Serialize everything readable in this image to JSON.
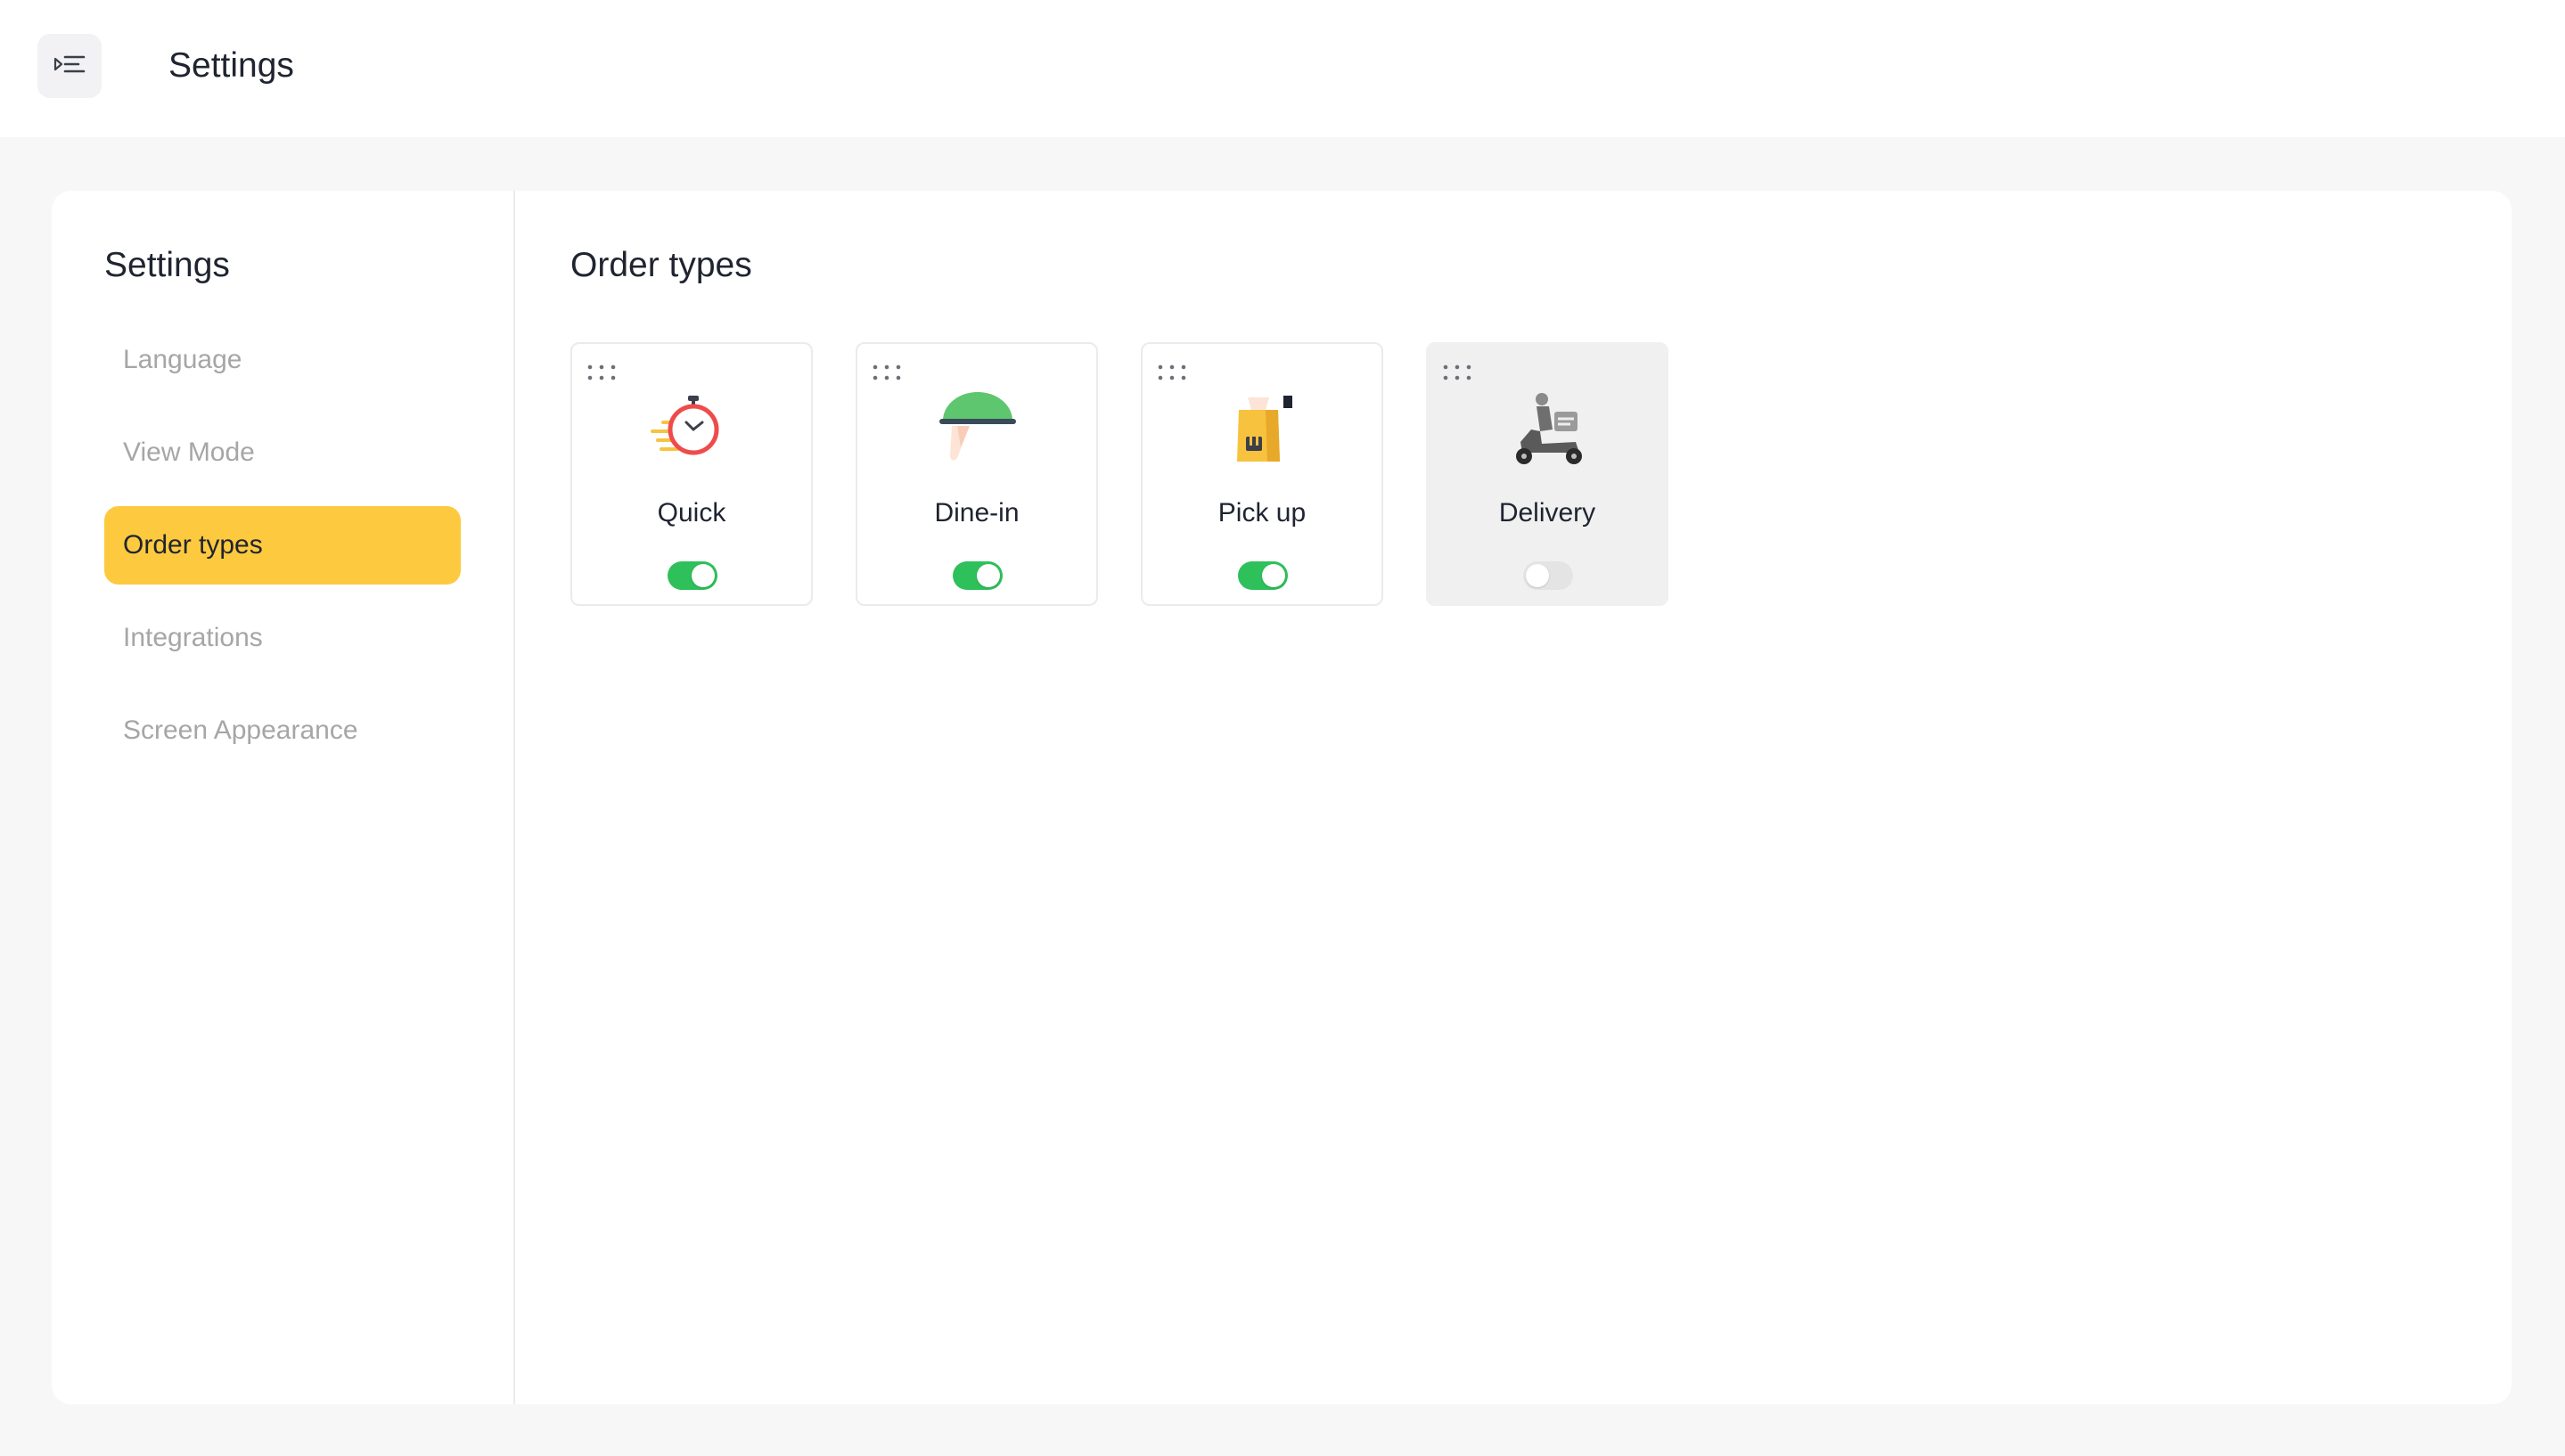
{
  "header": {
    "menu_icon": "menu-collapse-icon",
    "title": "Settings"
  },
  "sidebar": {
    "title": "Settings",
    "items": [
      {
        "label": "Language",
        "active": false
      },
      {
        "label": "View Mode",
        "active": false
      },
      {
        "label": "Order types",
        "active": true
      },
      {
        "label": "Integrations",
        "active": false
      },
      {
        "label": "Screen Appearance",
        "active": false
      }
    ]
  },
  "main": {
    "title": "Order types",
    "order_types": [
      {
        "label": "Quick",
        "icon": "stopwatch-icon",
        "enabled": true
      },
      {
        "label": "Dine-in",
        "icon": "serving-cloche-icon",
        "enabled": true
      },
      {
        "label": "Pick up",
        "icon": "takeout-bag-icon",
        "enabled": true
      },
      {
        "label": "Delivery",
        "icon": "delivery-scooter-icon",
        "enabled": false
      }
    ]
  },
  "colors": {
    "accent": "#fdc93f",
    "toggle_on": "#2ec05a",
    "toggle_off": "#e4e4e4"
  }
}
